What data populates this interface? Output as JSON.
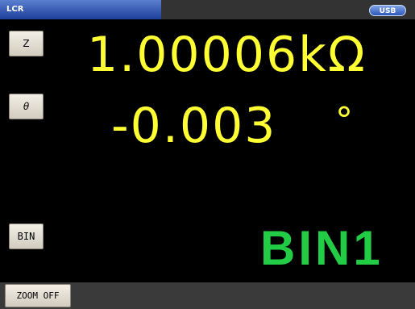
{
  "title_bar": {
    "mode": "LCR",
    "interface_badge": "USB"
  },
  "parameters": {
    "primary": {
      "label": "Z",
      "value": "1.00006kΩ"
    },
    "secondary": {
      "label": "θ",
      "value": "-0.003",
      "unit": "°"
    }
  },
  "comparator": {
    "button_label": "BIN",
    "result": "BIN1"
  },
  "footer": {
    "zoom_label": "ZOOM OFF"
  },
  "colors": {
    "reading": "#ffff33",
    "bin_result": "#22cc44",
    "mode_tab": "#2a4fb0"
  }
}
